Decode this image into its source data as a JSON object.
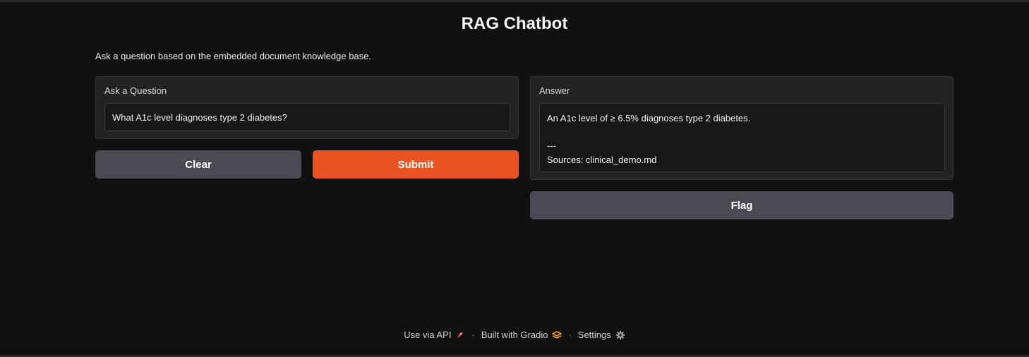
{
  "header": {
    "title": "RAG Chatbot",
    "description": "Ask a question based on the embedded document knowledge base."
  },
  "question": {
    "label": "Ask a Question",
    "value": "What A1c level diagnoses type 2 diabetes?"
  },
  "answer": {
    "label": "Answer",
    "value": "An A1c level of ≥ 6.5% diagnoses type 2 diabetes.\n\n---\nSources: clinical_demo.md"
  },
  "buttons": {
    "clear": "Clear",
    "submit": "Submit",
    "flag": "Flag"
  },
  "footer": {
    "api": "Use via API",
    "gradio": "Built with Gradio",
    "settings": "Settings",
    "separator": "·",
    "api_icon": "rocket-icon",
    "gradio_icon": "gradio-logo-icon",
    "settings_icon": "gear-icon"
  },
  "colors": {
    "background": "#111112",
    "panel": "#232326",
    "primary": "#ea5322",
    "secondary": "#4a4a52"
  }
}
